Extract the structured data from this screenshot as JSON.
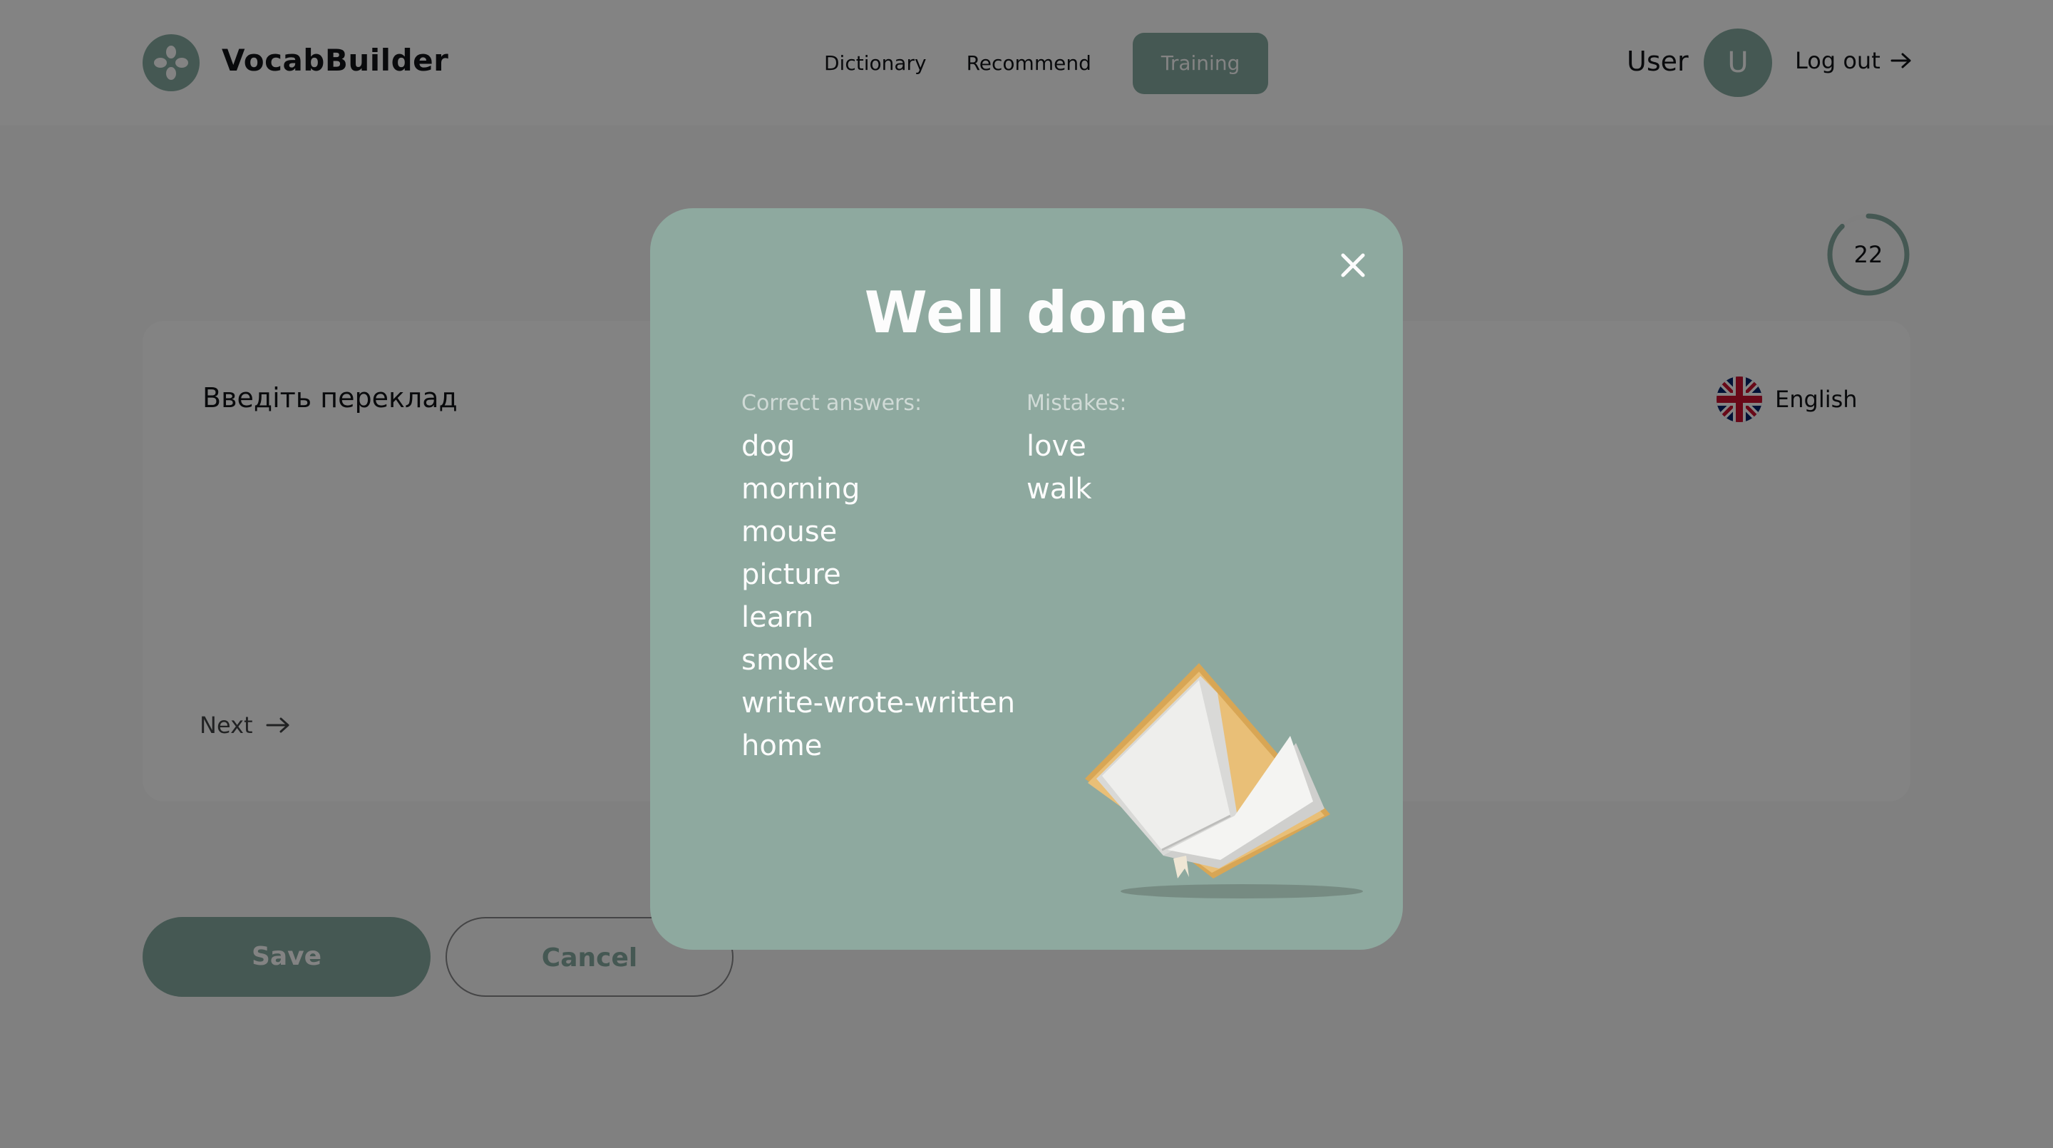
{
  "app": {
    "brand": "VocabBuilder"
  },
  "nav": {
    "items": [
      {
        "label": "Dictionary"
      },
      {
        "label": "Recommend"
      },
      {
        "label": "Training"
      }
    ]
  },
  "user": {
    "name": "User",
    "initial": "U",
    "logout_label": "Log out"
  },
  "progress": {
    "value": "22",
    "fraction": 0.88
  },
  "card": {
    "prompt": "Введіть переклад",
    "next_label": "Next",
    "language": "English"
  },
  "buttons": {
    "save": "Save",
    "cancel": "Cancel"
  },
  "modal": {
    "title": "Well done",
    "correct_label": "Correct answers:",
    "mistakes_label": "Mistakes:",
    "correct": [
      "dog",
      "morning",
      "mouse",
      "picture",
      "learn",
      "smoke",
      "write-wrote-written",
      "home"
    ],
    "mistakes": [
      "love",
      "walk"
    ]
  },
  "colors": {
    "accent": "#85aa9f",
    "modal_bg": "#8ea99f",
    "text": "#121417",
    "white": "#fcfcfc"
  },
  "icons": {
    "logo": "clover-logo-icon",
    "logout": "arrow-right-icon",
    "next": "arrow-right-icon",
    "flag": "uk-flag-icon",
    "close": "close-icon",
    "illustration": "open-book-illustration"
  }
}
